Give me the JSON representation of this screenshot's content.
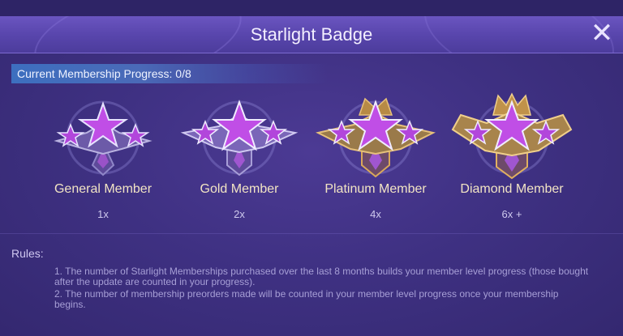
{
  "header": {
    "title": "Starlight Badge"
  },
  "progress": {
    "label": "Current Membership Progress: 0/8",
    "current": 0,
    "total": 8
  },
  "badges": [
    {
      "name": "General Member",
      "multiplier": "1x"
    },
    {
      "name": "Gold Member",
      "multiplier": "2x"
    },
    {
      "name": "Platinum Member",
      "multiplier": "4x"
    },
    {
      "name": "Diamond Member",
      "multiplier": "6x +"
    }
  ],
  "rules": {
    "title": "Rules:",
    "items": [
      "1. The number of Starlight Memberships purchased over the last 8 months builds your member level progress (those bought after the update are counted in your progress).",
      "2. The number of membership preorders made will be counted in your member level progress once your membership begins."
    ]
  },
  "colors": {
    "accent": "#b04ed8",
    "gold": "#d9a85a",
    "text": "#f2e4c4"
  },
  "icons": {
    "close": "close-icon",
    "badge": "star-badge-icon"
  }
}
